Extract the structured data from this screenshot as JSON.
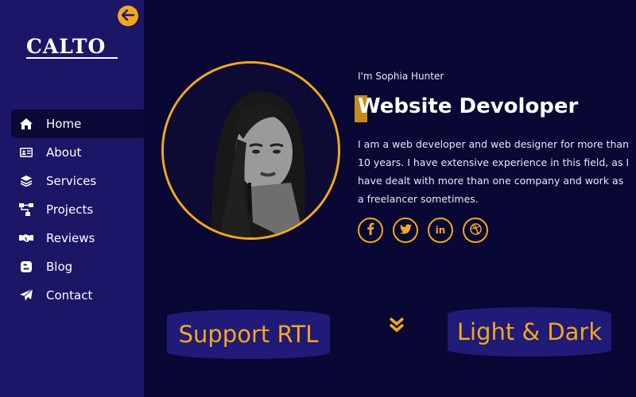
{
  "brand": {
    "logo_text": "CALTO"
  },
  "sidebar": {
    "items": [
      {
        "label": "Home",
        "icon": "home-icon",
        "active": true
      },
      {
        "label": "About",
        "icon": "id-card-icon",
        "active": false
      },
      {
        "label": "Services",
        "icon": "layers-icon",
        "active": false
      },
      {
        "label": "Projects",
        "icon": "sitemap-icon",
        "active": false
      },
      {
        "label": "Reviews",
        "icon": "handshake-icon",
        "active": false
      },
      {
        "label": "Blog",
        "icon": "blogger-icon",
        "active": false
      },
      {
        "label": "Contact",
        "icon": "paper-plane-icon",
        "active": false
      }
    ]
  },
  "hero": {
    "intro": "I'm Sophia Hunter",
    "title": "Website Devoloper",
    "description": "I am a web developer and web designer for more than 10 years. I have extensive experience in this field, as I have dealt with more than one company and work as a freelancer sometimes.",
    "socials": [
      {
        "name": "facebook-icon",
        "glyph": "f"
      },
      {
        "name": "twitter-icon",
        "glyph": "t"
      },
      {
        "name": "linkedin-icon",
        "glyph": "in"
      },
      {
        "name": "dribbble-icon",
        "glyph": "◎"
      }
    ]
  },
  "features": {
    "rtl_label": "Support RTL",
    "theme_label": "Light & Dark"
  },
  "colors": {
    "background": "#090733",
    "sidebar": "#1b1666",
    "accent": "#f3a81c",
    "pill": "#201a78"
  }
}
